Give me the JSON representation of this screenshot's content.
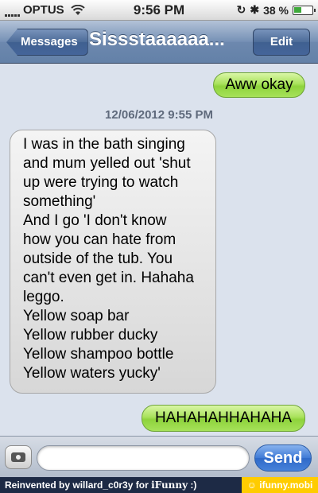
{
  "status_bar": {
    "carrier": "OPTUS",
    "time": "9:56 PM",
    "battery": "38 %"
  },
  "nav": {
    "back_label": "Messages",
    "title": "Sissstaaaaaa...",
    "edit_label": "Edit"
  },
  "messages": [
    {
      "direction": "sent",
      "text": "Aww okay"
    },
    {
      "direction": "received",
      "lines": [
        "I was in the bath singing",
        "and mum yelled out 'shut",
        "up were trying to watch",
        "something'",
        "And I go 'I don't know",
        "how you can hate from",
        "outside of the tub. You",
        "can't even get in. Hahaha",
        "leggo.",
        "Yellow soap bar",
        "Yellow rubber ducky",
        "Yellow shampoo bottle",
        "Yellow waters yucky'"
      ]
    },
    {
      "direction": "sent",
      "text": "HAHAHAHHAHAHA"
    }
  ],
  "timestamp": "12/06/2012 9:55 PM",
  "input": {
    "value": "",
    "send_label": "Send"
  },
  "footer": {
    "prefix": "Reinvented by willard_c0r3y for ",
    "brand": "iFunny",
    "suffix": " :)",
    "site": "ifunny.mobi"
  },
  "colors": {
    "nav_blue": "#6d88ae",
    "sent_green": "#8ed33c",
    "send_blue": "#2f69c8",
    "footer_bg": "#1d2a45",
    "footer_badge": "#ffcc00"
  }
}
